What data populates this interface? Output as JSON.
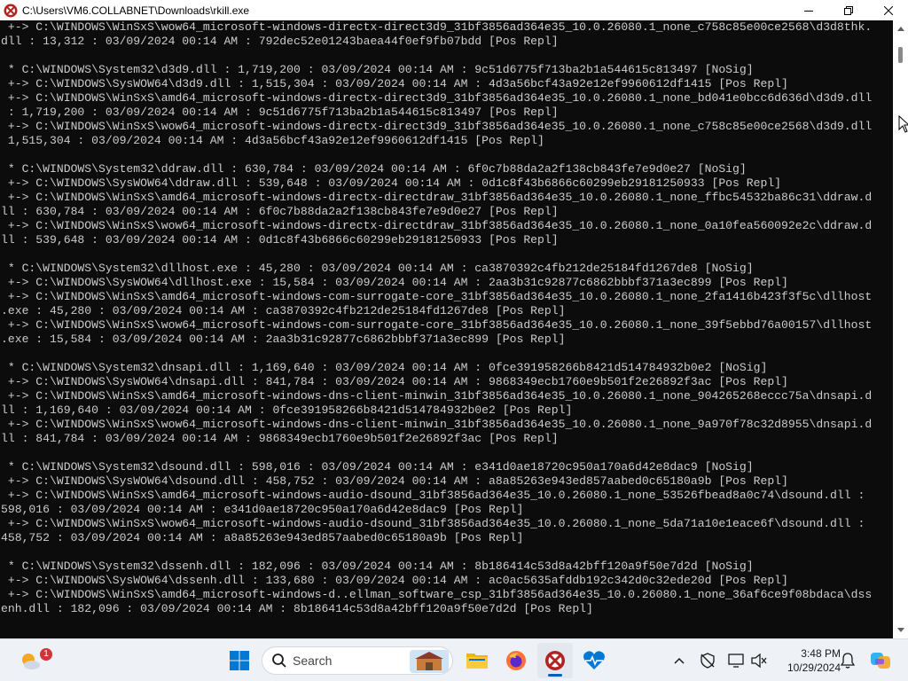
{
  "window": {
    "title": "C:\\Users\\VM6.COLLABNET\\Downloads\\rkill.exe"
  },
  "console": {
    "lines": [
      " +-> C:\\WINDOWS\\WinSxS\\wow64_microsoft-windows-directx-direct3d9_31bf3856ad364e35_10.0.26080.1_none_c758c85e00ce2568\\d3d8thk.",
      "dll : 13,312 : 03/09/2024 00:14 AM : 792dec52e01243baea44f0ef9fb07bdd [Pos Repl]",
      "",
      " * C:\\WINDOWS\\System32\\d3d9.dll : 1,719,200 : 03/09/2024 00:14 AM : 9c51d6775f713ba2b1a544615c813497 [NoSig]",
      " +-> C:\\WINDOWS\\SysWOW64\\d3d9.dll : 1,515,304 : 03/09/2024 00:14 AM : 4d3a56bcf43a92e12ef9960612df1415 [Pos Repl]",
      " +-> C:\\WINDOWS\\WinSxS\\amd64_microsoft-windows-directx-direct3d9_31bf3856ad364e35_10.0.26080.1_none_bd041e0bcc6d636d\\d3d9.dll",
      " : 1,719,200 : 03/09/2024 00:14 AM : 9c51d6775f713ba2b1a544615c813497 [Pos Repl]",
      " +-> C:\\WINDOWS\\WinSxS\\wow64_microsoft-windows-directx-direct3d9_31bf3856ad364e35_10.0.26080.1_none_c758c85e00ce2568\\d3d9.dll",
      " 1,515,304 : 03/09/2024 00:14 AM : 4d3a56bcf43a92e12ef9960612df1415 [Pos Repl]",
      "",
      " * C:\\WINDOWS\\System32\\ddraw.dll : 630,784 : 03/09/2024 00:14 AM : 6f0c7b88da2a2f138cb843fe7e9d0e27 [NoSig]",
      " +-> C:\\WINDOWS\\SysWOW64\\ddraw.dll : 539,648 : 03/09/2024 00:14 AM : 0d1c8f43b6866c60299eb29181250933 [Pos Repl]",
      " +-> C:\\WINDOWS\\WinSxS\\amd64_microsoft-windows-directx-directdraw_31bf3856ad364e35_10.0.26080.1_none_ffbc54532ba86c31\\ddraw.d",
      "ll : 630,784 : 03/09/2024 00:14 AM : 6f0c7b88da2a2f138cb843fe7e9d0e27 [Pos Repl]",
      " +-> C:\\WINDOWS\\WinSxS\\wow64_microsoft-windows-directx-directdraw_31bf3856ad364e35_10.0.26080.1_none_0a10fea560092e2c\\ddraw.d",
      "ll : 539,648 : 03/09/2024 00:14 AM : 0d1c8f43b6866c60299eb29181250933 [Pos Repl]",
      "",
      " * C:\\WINDOWS\\System32\\dllhost.exe : 45,280 : 03/09/2024 00:14 AM : ca3870392c4fb212de25184fd1267de8 [NoSig]",
      " +-> C:\\WINDOWS\\SysWOW64\\dllhost.exe : 15,584 : 03/09/2024 00:14 AM : 2aa3b31c92877c6862bbbf371a3ec899 [Pos Repl]",
      " +-> C:\\WINDOWS\\WinSxS\\amd64_microsoft-windows-com-surrogate-core_31bf3856ad364e35_10.0.26080.1_none_2fa1416b423f3f5c\\dllhost",
      ".exe : 45,280 : 03/09/2024 00:14 AM : ca3870392c4fb212de25184fd1267de8 [Pos Repl]",
      " +-> C:\\WINDOWS\\WinSxS\\wow64_microsoft-windows-com-surrogate-core_31bf3856ad364e35_10.0.26080.1_none_39f5ebbd76a00157\\dllhost",
      ".exe : 15,584 : 03/09/2024 00:14 AM : 2aa3b31c92877c6862bbbf371a3ec899 [Pos Repl]",
      "",
      " * C:\\WINDOWS\\System32\\dnsapi.dll : 1,169,640 : 03/09/2024 00:14 AM : 0fce391958266b8421d514784932b0e2 [NoSig]",
      " +-> C:\\WINDOWS\\SysWOW64\\dnsapi.dll : 841,784 : 03/09/2024 00:14 AM : 9868349ecb1760e9b501f2e26892f3ac [Pos Repl]",
      " +-> C:\\WINDOWS\\WinSxS\\amd64_microsoft-windows-dns-client-minwin_31bf3856ad364e35_10.0.26080.1_none_904265268eccc75a\\dnsapi.d",
      "ll : 1,169,640 : 03/09/2024 00:14 AM : 0fce391958266b8421d514784932b0e2 [Pos Repl]",
      " +-> C:\\WINDOWS\\WinSxS\\wow64_microsoft-windows-dns-client-minwin_31bf3856ad364e35_10.0.26080.1_none_9a970f78c32d8955\\dnsapi.d",
      "ll : 841,784 : 03/09/2024 00:14 AM : 9868349ecb1760e9b501f2e26892f3ac [Pos Repl]",
      "",
      " * C:\\WINDOWS\\System32\\dsound.dll : 598,016 : 03/09/2024 00:14 AM : e341d0ae18720c950a170a6d42e8dac9 [NoSig]",
      " +-> C:\\WINDOWS\\SysWOW64\\dsound.dll : 458,752 : 03/09/2024 00:14 AM : a8a85263e943ed857aabed0c65180a9b [Pos Repl]",
      " +-> C:\\WINDOWS\\WinSxS\\amd64_microsoft-windows-audio-dsound_31bf3856ad364e35_10.0.26080.1_none_53526fbead8a0c74\\dsound.dll :",
      "598,016 : 03/09/2024 00:14 AM : e341d0ae18720c950a170a6d42e8dac9 [Pos Repl]",
      " +-> C:\\WINDOWS\\WinSxS\\wow64_microsoft-windows-audio-dsound_31bf3856ad364e35_10.0.26080.1_none_5da71a10e1eace6f\\dsound.dll :",
      "458,752 : 03/09/2024 00:14 AM : a8a85263e943ed857aabed0c65180a9b [Pos Repl]",
      "",
      " * C:\\WINDOWS\\System32\\dssenh.dll : 182,096 : 03/09/2024 00:14 AM : 8b186414c53d8a42bff120a9f50e7d2d [NoSig]",
      " +-> C:\\WINDOWS\\SysWOW64\\dssenh.dll : 133,680 : 03/09/2024 00:14 AM : ac0ac5635afddb192c342d0c32ede20d [Pos Repl]",
      " +-> C:\\WINDOWS\\WinSxS\\amd64_microsoft-windows-d..ellman_software_csp_31bf3856ad364e35_10.0.26080.1_none_36af6ce9f08bdaca\\dss",
      "enh.dll : 182,096 : 03/09/2024 00:14 AM : 8b186414c53d8a42bff120a9f50e7d2d [Pos Repl]"
    ]
  },
  "taskbar": {
    "search_placeholder": "Search",
    "weather_badge": "1",
    "clock_time": "3:48 PM",
    "clock_date": "10/29/2024"
  },
  "icons": {
    "app": "rkill-icon",
    "start": "windows-start-icon",
    "search": "search-icon",
    "file_explorer": "folder-icon",
    "browser": "firefox-icon",
    "rkill": "rkill-icon",
    "health": "heart-pulse-icon",
    "tray_overflow": "chevron-up-icon",
    "network": "network-icon",
    "display": "display-icon",
    "sound": "speaker-icon",
    "notifications": "bell-icon"
  },
  "colors": {
    "console_bg": "#0c0c0c",
    "console_text": "#cccccc",
    "taskbar_bg": "#eef1f6",
    "accent": "#005fb8"
  }
}
